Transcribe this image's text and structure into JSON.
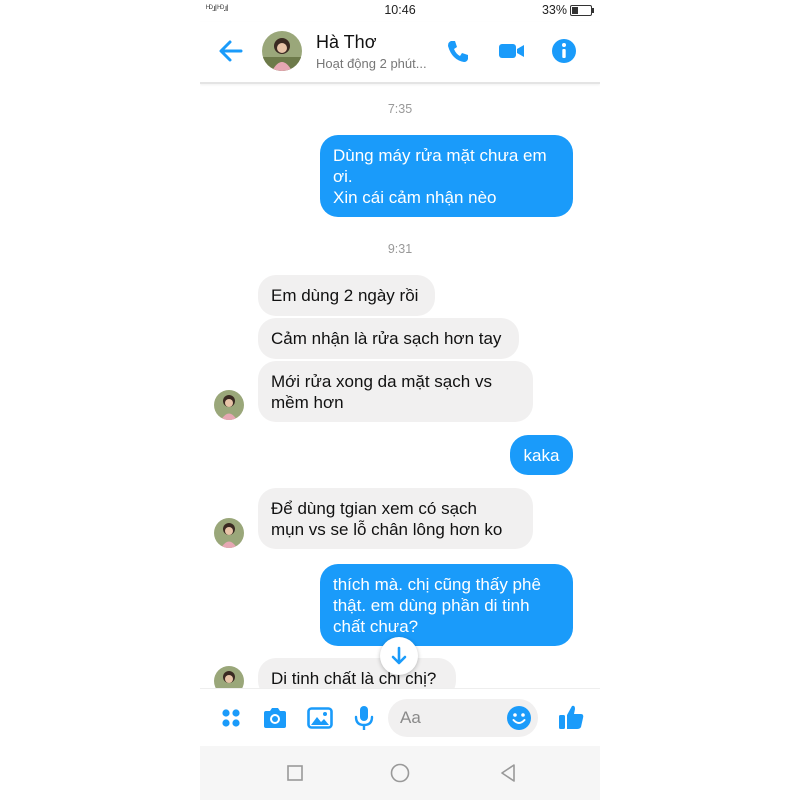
{
  "status_bar": {
    "signal": "ᴴᴰ.ıl ᴴᴰ.ıl",
    "time": "10:46",
    "battery_text": "33%",
    "battery_level": 0.33
  },
  "header": {
    "contact_name": "Hà Thơ",
    "contact_status": "Hoạt động 2 phút..."
  },
  "messages": [
    {
      "type": "timestamp",
      "text": "7:35"
    },
    {
      "type": "outgoing",
      "text": "Dùng máy rửa mặt chưa em\nơi.\nXin cái cảm nhận nèo"
    },
    {
      "type": "timestamp",
      "text": "9:31"
    },
    {
      "type": "incoming",
      "text": "Em dùng 2 ngày rồi"
    },
    {
      "type": "incoming",
      "text": "Cảm nhận là rửa sạch hơn tay"
    },
    {
      "type": "incoming",
      "text": "Mới rửa xong da mặt sạch vs\nmềm hơn"
    },
    {
      "type": "outgoing",
      "text": "kaka"
    },
    {
      "type": "incoming",
      "text": "Để dùng tgian xem có sạch\nmụn vs se lỗ chân lông hơn ko"
    },
    {
      "type": "outgoing",
      "text": "thích mà. chị cũng thấy phê\nthật. em dùng phần di tinh\nchất chưa?"
    },
    {
      "type": "incoming",
      "text": "Di tinh chất là chi chị?"
    }
  ],
  "composer": {
    "placeholder": "Aa"
  },
  "colors": {
    "accent": "#1a9bfa",
    "incoming_bubble": "#f1f0f0",
    "outgoing_text": "#ffffff"
  },
  "icons": {
    "back": "arrow-left-icon",
    "call": "phone-icon",
    "video": "video-camera-icon",
    "info": "info-icon",
    "apps": "four-dots-icon",
    "camera": "camera-icon",
    "gallery": "image-icon",
    "mic": "microphone-icon",
    "emoji": "smiley-icon",
    "like": "thumbs-up-icon",
    "scroll": "arrow-down-icon",
    "nav_recents": "square-icon",
    "nav_home": "circle-icon",
    "nav_back": "triangle-back-icon"
  }
}
